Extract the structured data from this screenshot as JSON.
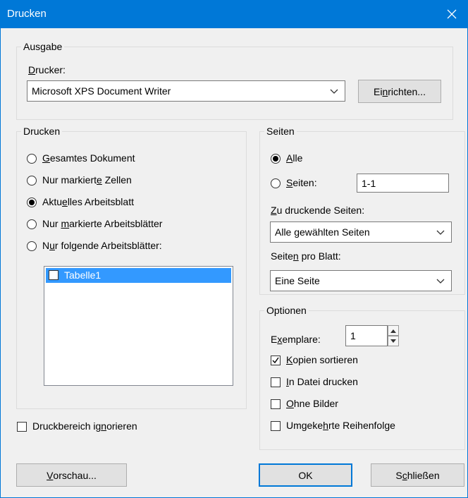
{
  "window": {
    "title": "Drucken",
    "close_glyph": "✕"
  },
  "ausgabe": {
    "legend": "Ausgabe",
    "printer_label": {
      "pre": "",
      "key": "D",
      "post": "rucker:"
    },
    "printer_value": "Microsoft XPS Document Writer",
    "setup_button": {
      "pre": "Ei",
      "key": "n",
      "post": "richten..."
    }
  },
  "drucken": {
    "legend": "Drucken",
    "options": [
      {
        "pre": "",
        "key": "G",
        "post": "esamtes Dokument",
        "checked": false
      },
      {
        "pre": "Nur markiert",
        "key": "e",
        "post": " Zellen",
        "checked": false
      },
      {
        "pre": "Aktu",
        "key": "e",
        "post": "lles Arbeitsblatt",
        "checked": true
      },
      {
        "pre": "Nur ",
        "key": "m",
        "post": "arkierte Arbeitsblätter",
        "checked": false
      },
      {
        "pre": "N",
        "key": "u",
        "post": "r folgende Arbeitsblätter:",
        "checked": false
      }
    ],
    "sheets": [
      {
        "label": "Tabelle1",
        "checked": false,
        "selected": true
      }
    ]
  },
  "seiten": {
    "legend": "Seiten",
    "all_label": {
      "pre": "",
      "key": "A",
      "post": "lle"
    },
    "pages_label": {
      "pre": "",
      "key": "S",
      "post": "eiten:"
    },
    "all_checked": true,
    "pages_value": "1-1",
    "print_pages_label": {
      "pre": "",
      "key": "Z",
      "post": "u druckende Seiten:"
    },
    "print_pages_value": "Alle gewählten Seiten",
    "per_sheet_label": {
      "pre": "Seite",
      "key": "n",
      "post": " pro Blatt:"
    },
    "per_sheet_value": "Eine Seite"
  },
  "optionen": {
    "legend": "Optionen",
    "copies_label": {
      "pre": "E",
      "key": "x",
      "post": "emplare:"
    },
    "copies_value": "1",
    "checks": [
      {
        "pre": "",
        "key": "K",
        "post": "opien sortieren",
        "checked": true
      },
      {
        "pre": "",
        "key": "I",
        "post": "n Datei drucken",
        "checked": false
      },
      {
        "pre": "",
        "key": "O",
        "post": "hne Bilder",
        "checked": false
      },
      {
        "pre": "Umgeke",
        "key": "h",
        "post": "rte Reihenfolge",
        "checked": false
      }
    ]
  },
  "ignore_print_area": {
    "pre": "Druckbereich ig",
    "key": "n",
    "post": "orieren",
    "checked": false
  },
  "buttons": {
    "preview": {
      "pre": "",
      "key": "V",
      "post": "orschau..."
    },
    "ok": "OK",
    "close": {
      "pre": "S",
      "key": "c",
      "post": "hließen"
    }
  },
  "icons": {
    "close": "close-icon",
    "dropdown": "chevron-down-icon",
    "check": "checkmark-icon",
    "spin_up": "spin-up-icon",
    "spin_down": "spin-down-icon"
  }
}
